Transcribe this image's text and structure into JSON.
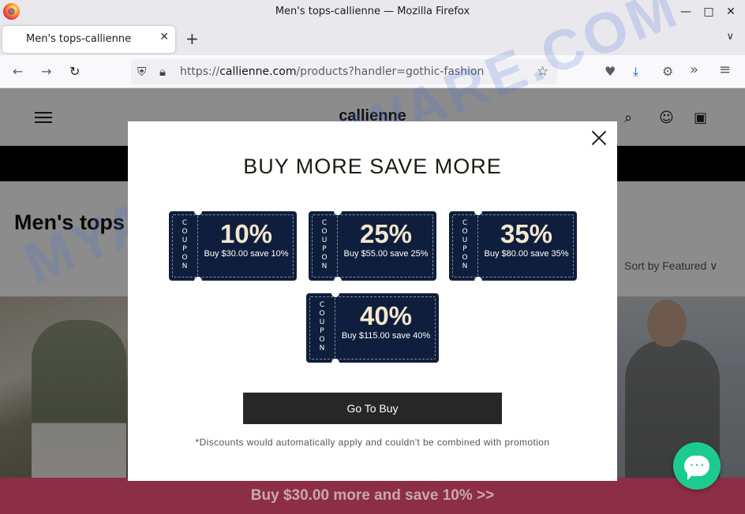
{
  "window": {
    "title": "Men's tops-callienne — Mozilla Firefox",
    "minimize": "—",
    "maximize": "□",
    "close": "✕"
  },
  "tab": {
    "label": "Men's tops-callienne",
    "close": "✕",
    "new_tab": "+",
    "list_all": "∨"
  },
  "nav": {
    "back": "←",
    "forward": "→",
    "reload": "↻",
    "url_scheme": "https://",
    "url_host": "callienne.com",
    "url_path": "/products?handler=gothic-fashion",
    "bookmark_icon": "☆",
    "pocket_icon": "♥",
    "download_icon": "⤓",
    "extensions_icon": "⚙",
    "overflow_icon": "»",
    "menu_icon": "≡"
  },
  "site": {
    "logo": "callienne",
    "search_icon": "⌕",
    "account_icon": "☺",
    "cart_icon": "▣",
    "page_title": "Men's tops",
    "sort_label": "Sort by  Featured  ∨",
    "promo_text": "Buy $30.00 more and save 10%  >>"
  },
  "modal": {
    "title": "BUY MORE SAVE MORE",
    "coupon_word": [
      "C",
      "O",
      "U",
      "P",
      "O",
      "N"
    ],
    "coupons": [
      {
        "pct": "10%",
        "cond": "Buy $30.00 save 10%"
      },
      {
        "pct": "25%",
        "cond": "Buy $55.00 save 25%"
      },
      {
        "pct": "35%",
        "cond": "Buy $80.00 save 35%"
      },
      {
        "pct": "40%",
        "cond": "Buy $115.00 save 40%"
      }
    ],
    "button": "Go To Buy",
    "disclaimer": "*Discounts would automatically apply and couldn't be combined with promotion"
  },
  "chat": {
    "dots": "•••"
  },
  "watermark": "MYANTISPYWARE.COM",
  "colors": {
    "coupon_bg": "#0f1e3c",
    "coupon_pct": "#f3e7cf",
    "button_bg": "#272727",
    "chat_bg": "#1ecb8f",
    "promo_bar": "#8c2e45"
  }
}
